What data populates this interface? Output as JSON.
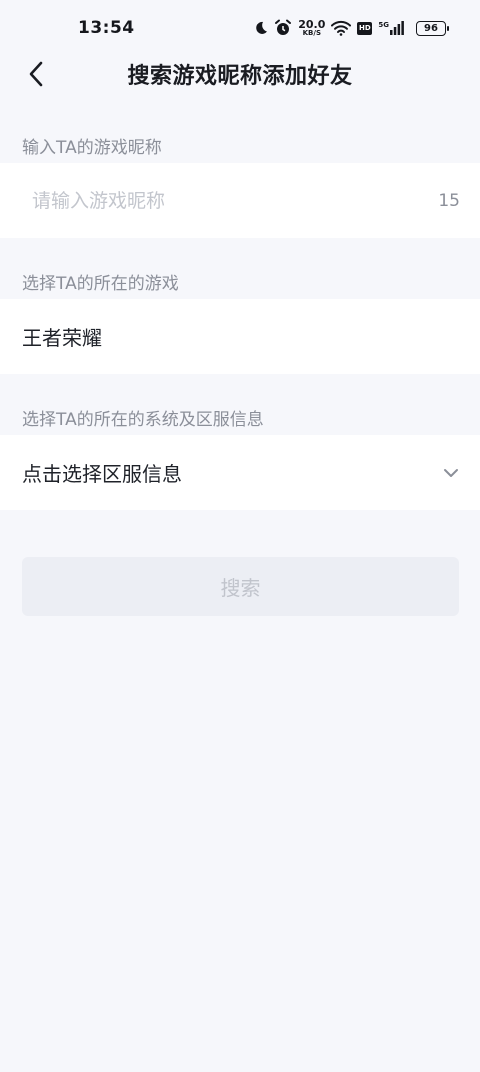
{
  "status_bar": {
    "time": "13:54",
    "net_speed_value": "20.0",
    "net_speed_unit": "KB/S",
    "hd_label": "HD",
    "network_label": "5G",
    "battery_level": "96"
  },
  "header": {
    "title": "搜索游戏昵称添加好友"
  },
  "nickname_section": {
    "label": "输入TA的游戏昵称",
    "placeholder": "请输入游戏昵称",
    "value": "",
    "char_limit": "15"
  },
  "game_section": {
    "label": "选择TA的所在的游戏",
    "selected_game": "王者荣耀"
  },
  "server_section": {
    "label": "选择TA的所在的系统及区服信息",
    "selected_value": "点击选择区服信息"
  },
  "search_button": {
    "label": "搜索"
  },
  "colors": {
    "background": "#f6f7fb",
    "card": "#ffffff",
    "label_gray": "#8b8f99",
    "disabled_button_bg": "#eceef4",
    "disabled_button_text": "#c1c4cc"
  }
}
